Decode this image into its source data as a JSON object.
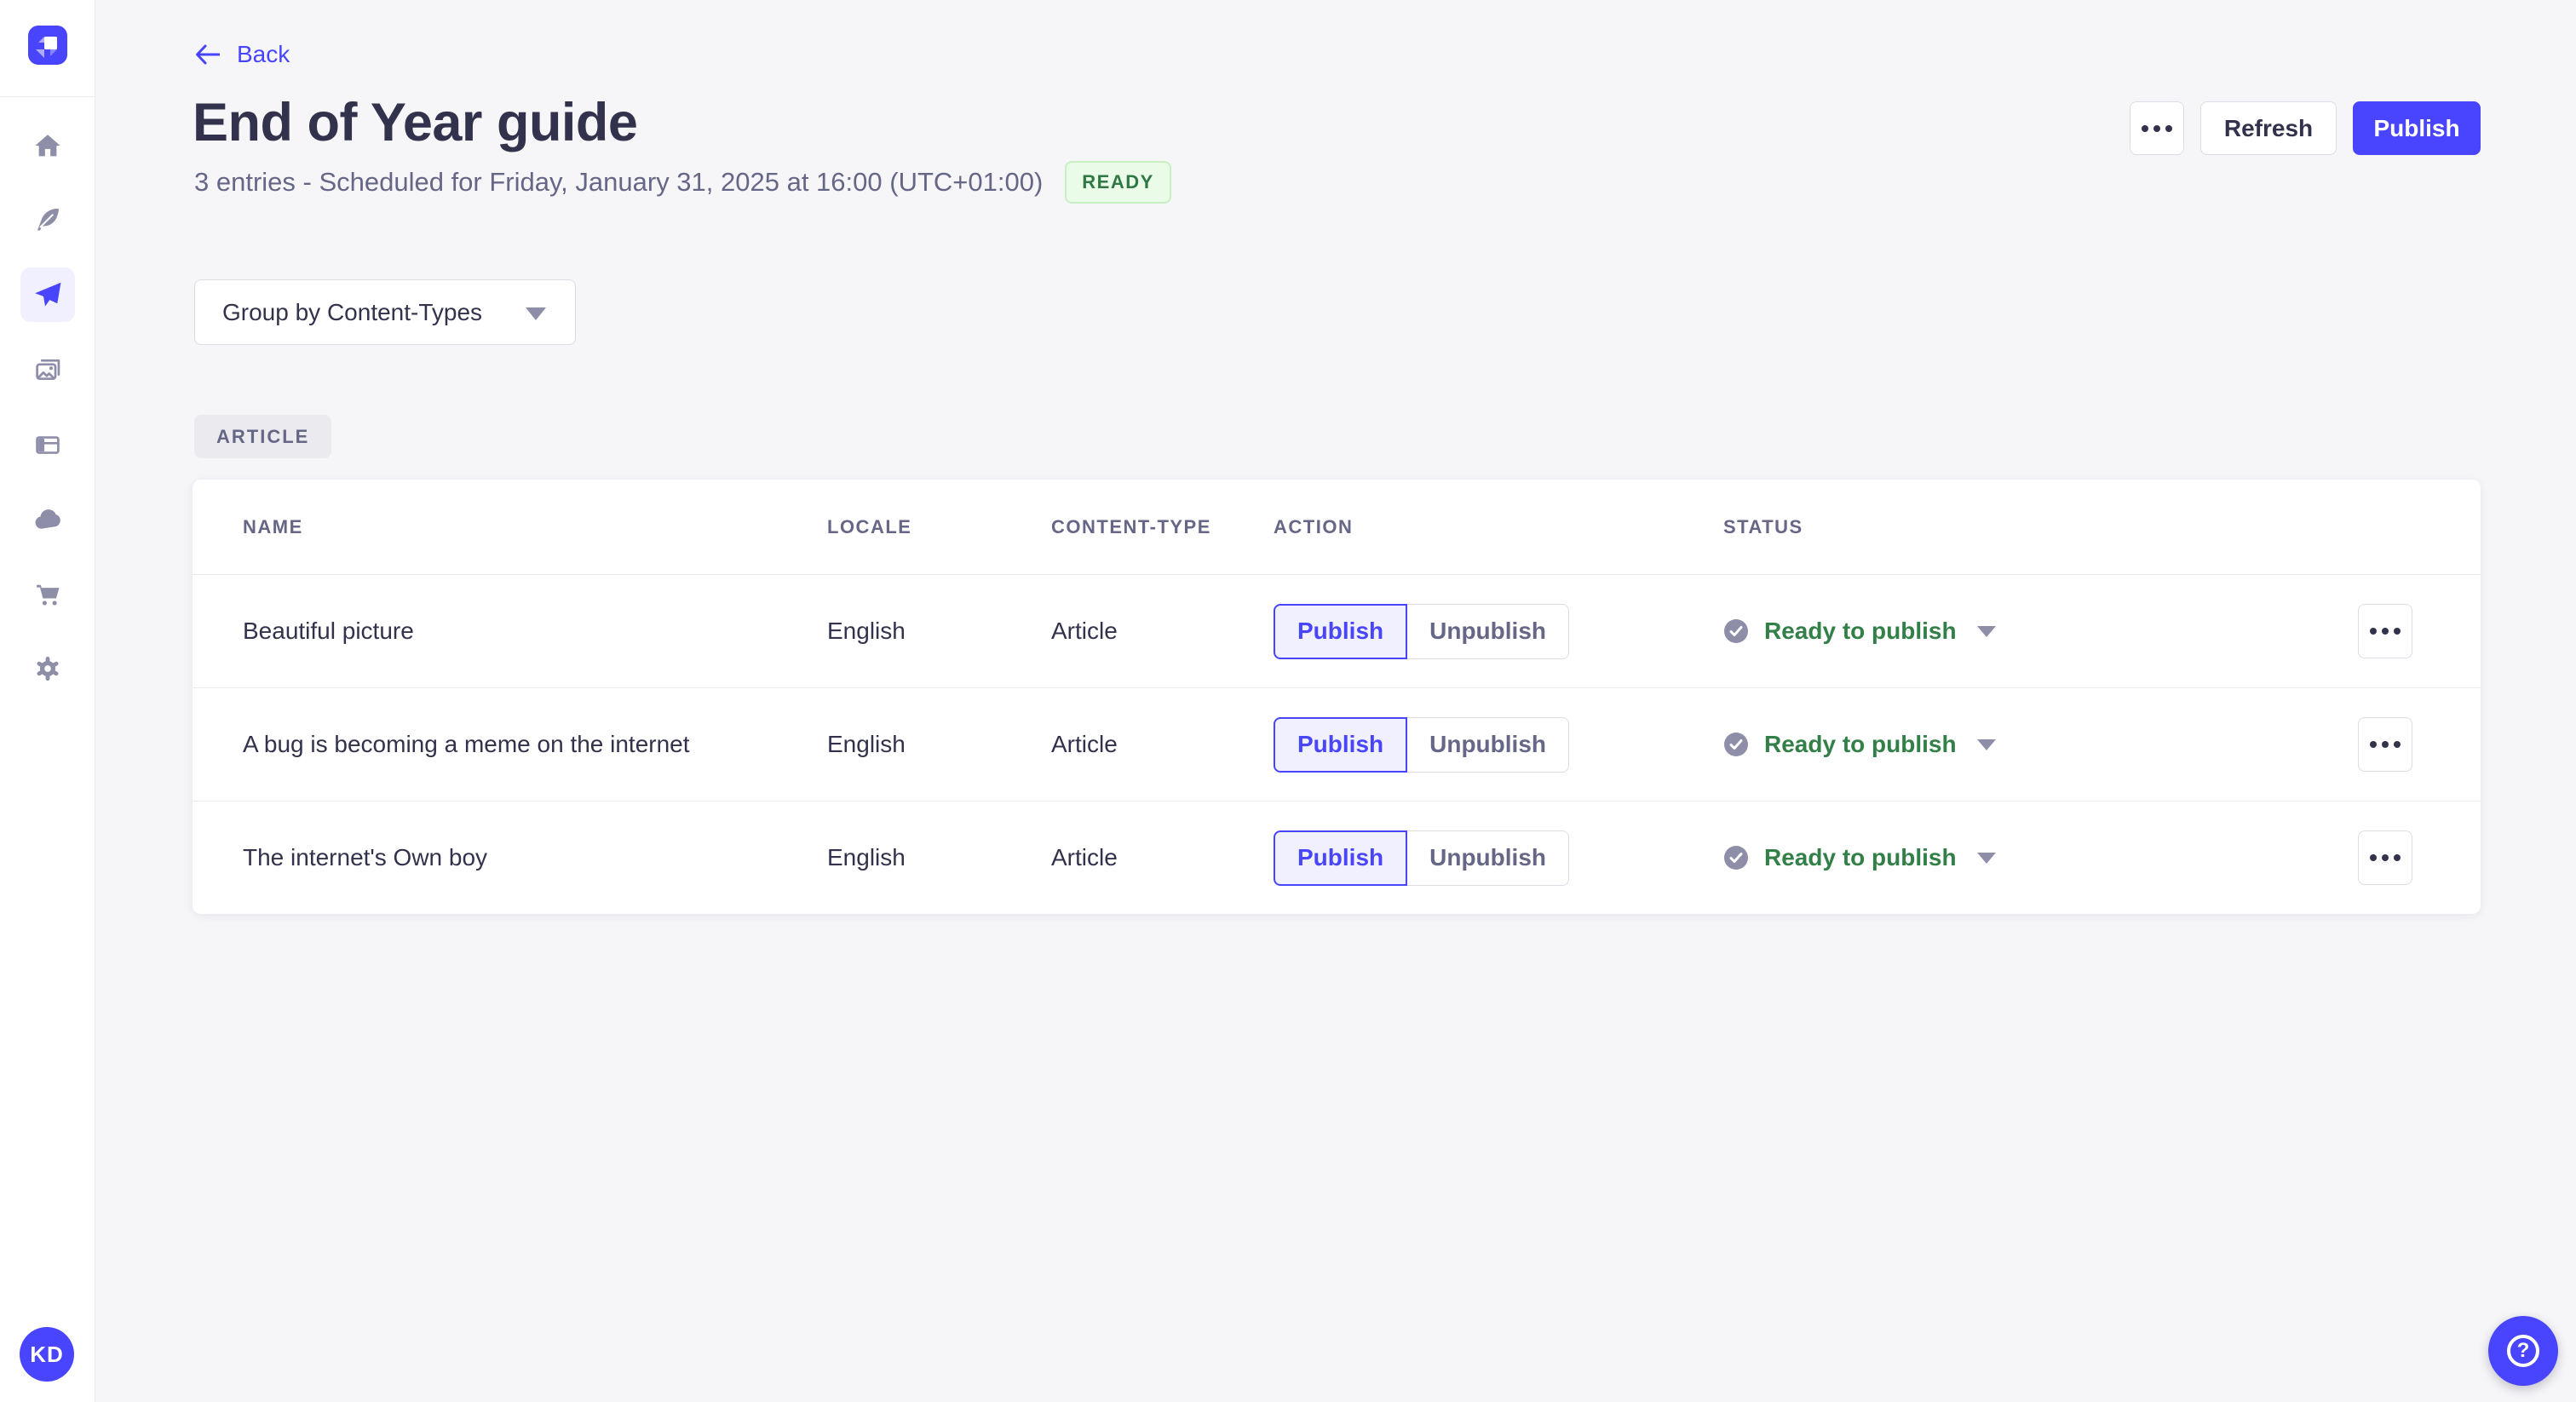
{
  "app": "Strapi Releases",
  "colors": {
    "primary": "#4945ff",
    "primary_light_bg": "#f0f0ff",
    "page_bg": "#f6f6f9",
    "success_text": "#2f7846",
    "success_bg": "#eafbe7",
    "success_border": "#c6f0c2",
    "status_green": "#328048",
    "neutral_icon": "#8e8ea9",
    "neutral_text": "#666687",
    "dark_text": "#32324d",
    "border": "#dcdce4",
    "divider": "#eaeaef"
  },
  "sidebar": {
    "avatar_initials": "KD",
    "items": [
      {
        "icon": "home-icon",
        "active": false
      },
      {
        "icon": "feather-icon",
        "active": false
      },
      {
        "icon": "paper-plane-icon",
        "active": true
      },
      {
        "icon": "pictures-icon",
        "active": false
      },
      {
        "icon": "layout-icon",
        "active": false
      },
      {
        "icon": "cloud-icon",
        "active": false
      },
      {
        "icon": "cart-icon",
        "active": false
      },
      {
        "icon": "gear-icon",
        "active": false
      }
    ]
  },
  "header": {
    "back_label": "Back",
    "title": "End of Year guide",
    "subtitle": "3 entries - Scheduled for Friday, January 31, 2025 at 16:00 (UTC+01:00)",
    "ready_badge": "READY",
    "refresh_label": "Refresh",
    "publish_label": "Publish"
  },
  "toolbar": {
    "group_by_label": "Group by Content-Types"
  },
  "group": {
    "badge": "ARTICLE"
  },
  "table": {
    "columns": [
      "NAME",
      "LOCALE",
      "CONTENT-TYPE",
      "ACTION",
      "STATUS"
    ],
    "rows": [
      {
        "name": "Beautiful picture",
        "locale": "English",
        "content_type": "Article",
        "publish_label": "Publish",
        "unpublish_label": "Unpublish",
        "status": "Ready to publish"
      },
      {
        "name": "A bug is becoming a meme on the internet",
        "locale": "English",
        "content_type": "Article",
        "publish_label": "Publish",
        "unpublish_label": "Unpublish",
        "status": "Ready to publish"
      },
      {
        "name": "The internet's Own boy",
        "locale": "English",
        "content_type": "Article",
        "publish_label": "Publish",
        "unpublish_label": "Unpublish",
        "status": "Ready to publish"
      }
    ]
  }
}
